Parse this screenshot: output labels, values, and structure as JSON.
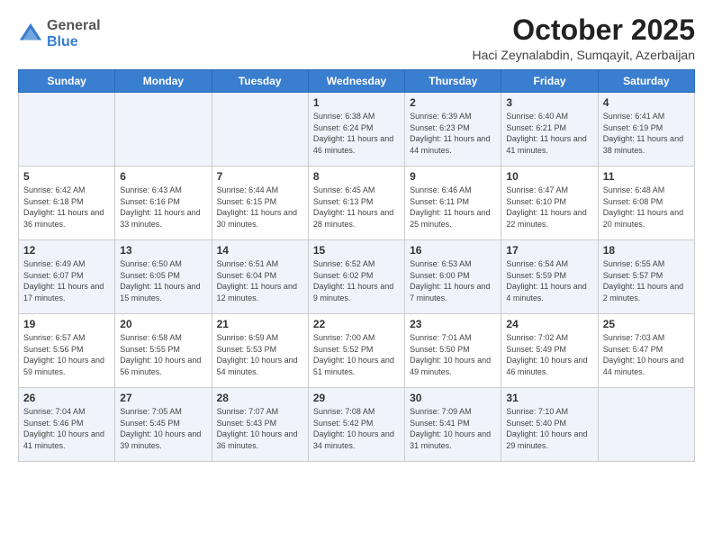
{
  "logo": {
    "general": "General",
    "blue": "Blue"
  },
  "title": "October 2025",
  "subtitle": "Haci Zeynalabdin, Sumqayit, Azerbaijan",
  "days_of_week": [
    "Sunday",
    "Monday",
    "Tuesday",
    "Wednesday",
    "Thursday",
    "Friday",
    "Saturday"
  ],
  "weeks": [
    [
      {
        "day": "",
        "info": ""
      },
      {
        "day": "",
        "info": ""
      },
      {
        "day": "",
        "info": ""
      },
      {
        "day": "1",
        "info": "Sunrise: 6:38 AM\nSunset: 6:24 PM\nDaylight: 11 hours\nand 46 minutes."
      },
      {
        "day": "2",
        "info": "Sunrise: 6:39 AM\nSunset: 6:23 PM\nDaylight: 11 hours\nand 44 minutes."
      },
      {
        "day": "3",
        "info": "Sunrise: 6:40 AM\nSunset: 6:21 PM\nDaylight: 11 hours\nand 41 minutes."
      },
      {
        "day": "4",
        "info": "Sunrise: 6:41 AM\nSunset: 6:19 PM\nDaylight: 11 hours\nand 38 minutes."
      }
    ],
    [
      {
        "day": "5",
        "info": "Sunrise: 6:42 AM\nSunset: 6:18 PM\nDaylight: 11 hours\nand 36 minutes."
      },
      {
        "day": "6",
        "info": "Sunrise: 6:43 AM\nSunset: 6:16 PM\nDaylight: 11 hours\nand 33 minutes."
      },
      {
        "day": "7",
        "info": "Sunrise: 6:44 AM\nSunset: 6:15 PM\nDaylight: 11 hours\nand 30 minutes."
      },
      {
        "day": "8",
        "info": "Sunrise: 6:45 AM\nSunset: 6:13 PM\nDaylight: 11 hours\nand 28 minutes."
      },
      {
        "day": "9",
        "info": "Sunrise: 6:46 AM\nSunset: 6:11 PM\nDaylight: 11 hours\nand 25 minutes."
      },
      {
        "day": "10",
        "info": "Sunrise: 6:47 AM\nSunset: 6:10 PM\nDaylight: 11 hours\nand 22 minutes."
      },
      {
        "day": "11",
        "info": "Sunrise: 6:48 AM\nSunset: 6:08 PM\nDaylight: 11 hours\nand 20 minutes."
      }
    ],
    [
      {
        "day": "12",
        "info": "Sunrise: 6:49 AM\nSunset: 6:07 PM\nDaylight: 11 hours\nand 17 minutes."
      },
      {
        "day": "13",
        "info": "Sunrise: 6:50 AM\nSunset: 6:05 PM\nDaylight: 11 hours\nand 15 minutes."
      },
      {
        "day": "14",
        "info": "Sunrise: 6:51 AM\nSunset: 6:04 PM\nDaylight: 11 hours\nand 12 minutes."
      },
      {
        "day": "15",
        "info": "Sunrise: 6:52 AM\nSunset: 6:02 PM\nDaylight: 11 hours\nand 9 minutes."
      },
      {
        "day": "16",
        "info": "Sunrise: 6:53 AM\nSunset: 6:00 PM\nDaylight: 11 hours\nand 7 minutes."
      },
      {
        "day": "17",
        "info": "Sunrise: 6:54 AM\nSunset: 5:59 PM\nDaylight: 11 hours\nand 4 minutes."
      },
      {
        "day": "18",
        "info": "Sunrise: 6:55 AM\nSunset: 5:57 PM\nDaylight: 11 hours\nand 2 minutes."
      }
    ],
    [
      {
        "day": "19",
        "info": "Sunrise: 6:57 AM\nSunset: 5:56 PM\nDaylight: 10 hours\nand 59 minutes."
      },
      {
        "day": "20",
        "info": "Sunrise: 6:58 AM\nSunset: 5:55 PM\nDaylight: 10 hours\nand 56 minutes."
      },
      {
        "day": "21",
        "info": "Sunrise: 6:59 AM\nSunset: 5:53 PM\nDaylight: 10 hours\nand 54 minutes."
      },
      {
        "day": "22",
        "info": "Sunrise: 7:00 AM\nSunset: 5:52 PM\nDaylight: 10 hours\nand 51 minutes."
      },
      {
        "day": "23",
        "info": "Sunrise: 7:01 AM\nSunset: 5:50 PM\nDaylight: 10 hours\nand 49 minutes."
      },
      {
        "day": "24",
        "info": "Sunrise: 7:02 AM\nSunset: 5:49 PM\nDaylight: 10 hours\nand 46 minutes."
      },
      {
        "day": "25",
        "info": "Sunrise: 7:03 AM\nSunset: 5:47 PM\nDaylight: 10 hours\nand 44 minutes."
      }
    ],
    [
      {
        "day": "26",
        "info": "Sunrise: 7:04 AM\nSunset: 5:46 PM\nDaylight: 10 hours\nand 41 minutes."
      },
      {
        "day": "27",
        "info": "Sunrise: 7:05 AM\nSunset: 5:45 PM\nDaylight: 10 hours\nand 39 minutes."
      },
      {
        "day": "28",
        "info": "Sunrise: 7:07 AM\nSunset: 5:43 PM\nDaylight: 10 hours\nand 36 minutes."
      },
      {
        "day": "29",
        "info": "Sunrise: 7:08 AM\nSunset: 5:42 PM\nDaylight: 10 hours\nand 34 minutes."
      },
      {
        "day": "30",
        "info": "Sunrise: 7:09 AM\nSunset: 5:41 PM\nDaylight: 10 hours\nand 31 minutes."
      },
      {
        "day": "31",
        "info": "Sunrise: 7:10 AM\nSunset: 5:40 PM\nDaylight: 10 hours\nand 29 minutes."
      },
      {
        "day": "",
        "info": ""
      }
    ]
  ]
}
